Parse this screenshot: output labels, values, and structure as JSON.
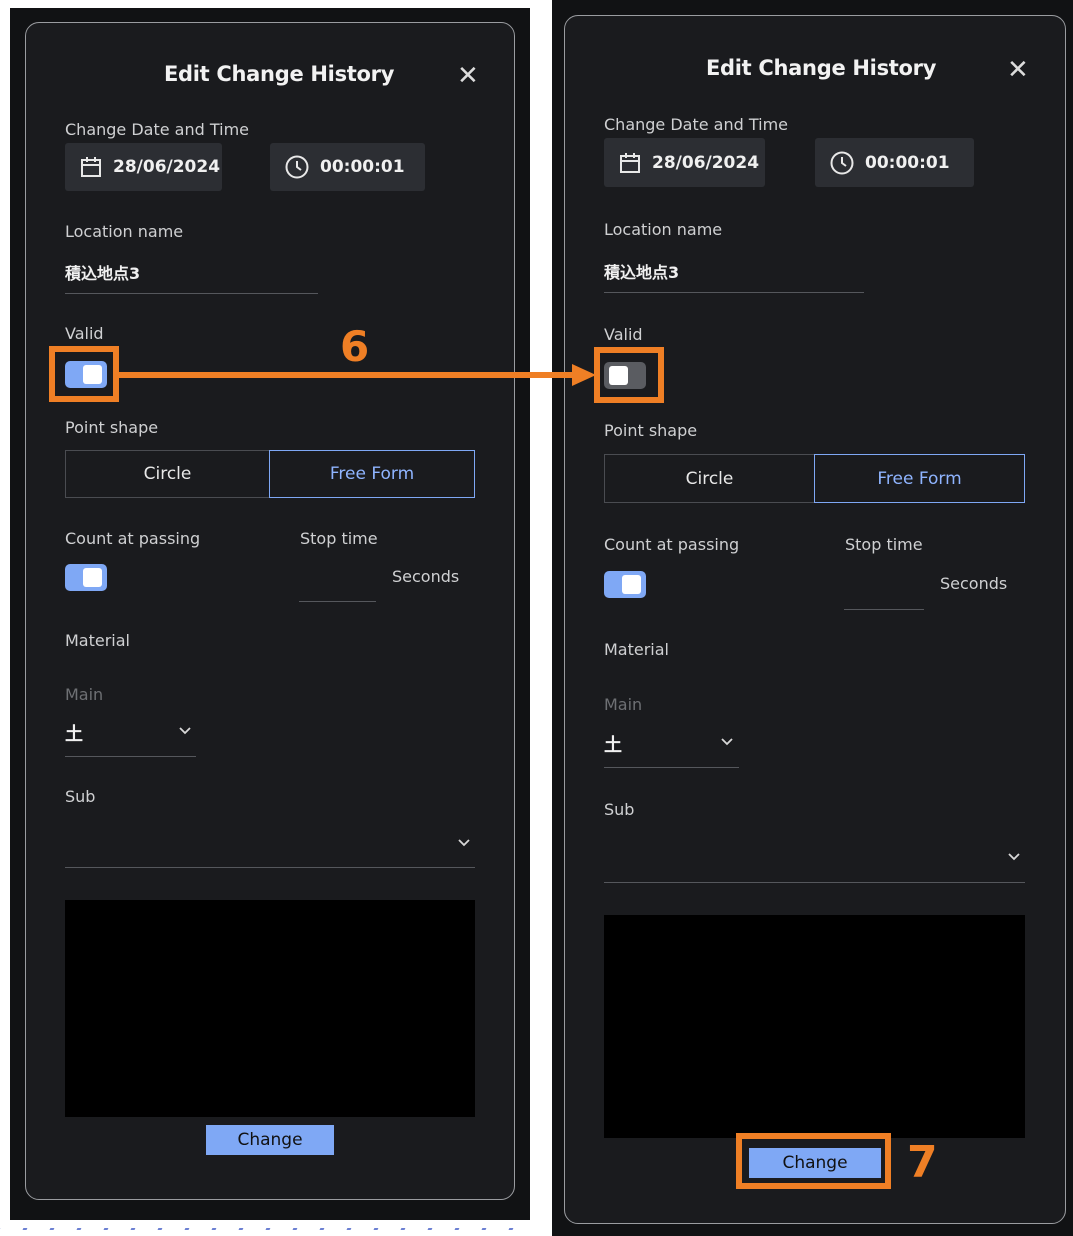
{
  "dialogs": [
    {
      "title": "Edit Change History",
      "close_symbol": "✕",
      "change_datetime_label": "Change Date and Time",
      "date_value": "28/06/2024",
      "time_value": "00:00:01",
      "location_label": "Location name",
      "location_value": "積込地点3",
      "valid_label": "Valid",
      "valid_on": true,
      "point_shape_label": "Point shape",
      "point_shape_options": [
        "Circle",
        "Free Form"
      ],
      "point_shape_selected": "Free Form",
      "count_label": "Count at passing",
      "count_on": true,
      "stop_time_label": "Stop time",
      "stop_time_value": "",
      "seconds_label": "Seconds",
      "material_label": "Material",
      "main_label": "Main",
      "main_value": "土",
      "sub_label": "Sub",
      "sub_value": "",
      "change_button": "Change"
    },
    {
      "title": "Edit Change History",
      "close_symbol": "✕",
      "change_datetime_label": "Change Date and Time",
      "date_value": "28/06/2024",
      "time_value": "00:00:01",
      "location_label": "Location name",
      "location_value": "積込地点3",
      "valid_label": "Valid",
      "valid_on": false,
      "point_shape_label": "Point shape",
      "point_shape_options": [
        "Circle",
        "Free Form"
      ],
      "point_shape_selected": "Free Form",
      "count_label": "Count at passing",
      "count_on": true,
      "stop_time_label": "Stop time",
      "stop_time_value": "",
      "seconds_label": "Seconds",
      "material_label": "Material",
      "main_label": "Main",
      "main_value": "土",
      "sub_label": "Sub",
      "sub_value": "",
      "change_button": "Change"
    }
  ],
  "annotations": {
    "step_6": "6",
    "step_7": "7",
    "highlight_color": "#ef7f25"
  },
  "colors": {
    "accent": "#7fa8f5",
    "dialog_bg": "#1a1b1e",
    "toggle_off": "#5a5c61"
  },
  "icons": [
    "calendar-icon",
    "clock-icon",
    "close-icon",
    "chevron-down-icon"
  ]
}
